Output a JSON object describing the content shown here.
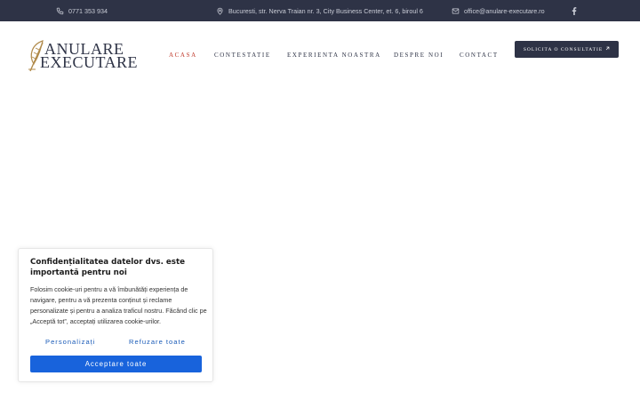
{
  "topbar": {
    "phone": "0771 353 934",
    "address": "Bucuresti, str. Nerva Traian nr. 3, City Business Center, et. 6, biroul 6",
    "email": "office@anulare-executare.ro",
    "social_icon": "facebook-icon"
  },
  "logo": {
    "line1": "ANULARE",
    "line2": "EXECUTARE"
  },
  "nav": {
    "items": [
      {
        "label": "ACASA",
        "active": true
      },
      {
        "label": "CONTESTATIE",
        "active": false
      },
      {
        "label": "EXPERIENTA NOASTRA",
        "active": false
      },
      {
        "label": "DESPRE NOI",
        "active": false
      },
      {
        "label": "CONTACT",
        "active": false
      }
    ]
  },
  "cta": {
    "label": "SOLICITA O CONSULTATIE"
  },
  "cookie": {
    "title": "Confidențialitatea datelor dvs. este importantă pentru noi",
    "text": "Folosim cookie-uri pentru a vă îmbunătăți experiența de navigare, pentru a vă prezenta conținut și reclame personalizate și pentru a analiza traficul nostru. Făcând clic pe „Acceptă tot”, acceptați utilizarea cookie-urilor.",
    "customize_label": "Personalizați",
    "reject_label": "Refuzare toate",
    "accept_label": "Acceptare toate"
  },
  "colors": {
    "brand_dark": "#2e3346",
    "nav_active": "#c0392b",
    "logo_gold": "#b08a4a",
    "accept_blue": "#1863dc"
  }
}
